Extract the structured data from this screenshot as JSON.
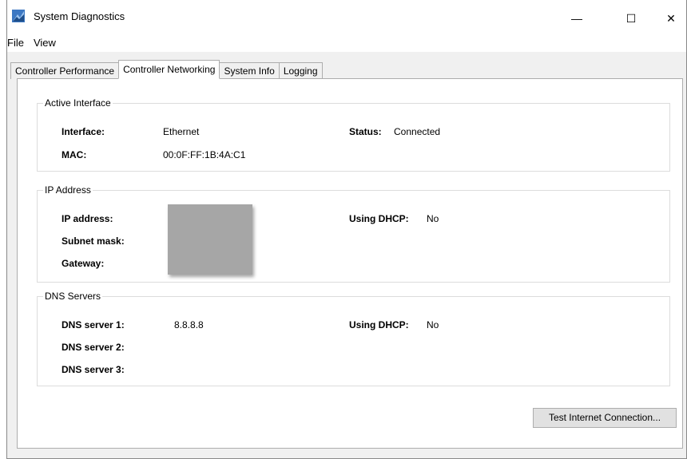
{
  "window": {
    "title": "System Diagnostics",
    "controls": {
      "minimize": "—",
      "maximize": "☐",
      "close": "✕"
    }
  },
  "menu": {
    "items": [
      "File",
      "View"
    ]
  },
  "tabs": [
    {
      "label": "Controller Performance",
      "active": false
    },
    {
      "label": "Controller Networking",
      "active": true
    },
    {
      "label": "System Info",
      "active": false
    },
    {
      "label": "Logging",
      "active": false
    }
  ],
  "active_interface": {
    "title": "Active Interface",
    "interface_label": "Interface:",
    "interface_value": "Ethernet",
    "mac_label": "MAC:",
    "mac_value": "00:0F:FF:1B:4A:C1",
    "status_label": "Status:",
    "status_value": "Connected"
  },
  "ip_address": {
    "title": "IP Address",
    "ip_label": "IP address:",
    "subnet_label": "Subnet mask:",
    "gateway_label": "Gateway:",
    "dhcp_label": "Using DHCP:",
    "dhcp_value": "No"
  },
  "dns_servers": {
    "title": "DNS Servers",
    "dns1_label": "DNS server 1:",
    "dns1_value": "8.8.8.8",
    "dns2_label": "DNS server 2:",
    "dns3_label": "DNS server 3:",
    "dhcp_label": "Using DHCP:",
    "dhcp_value": "No"
  },
  "actions": {
    "test_button": "Test Internet Connection..."
  }
}
